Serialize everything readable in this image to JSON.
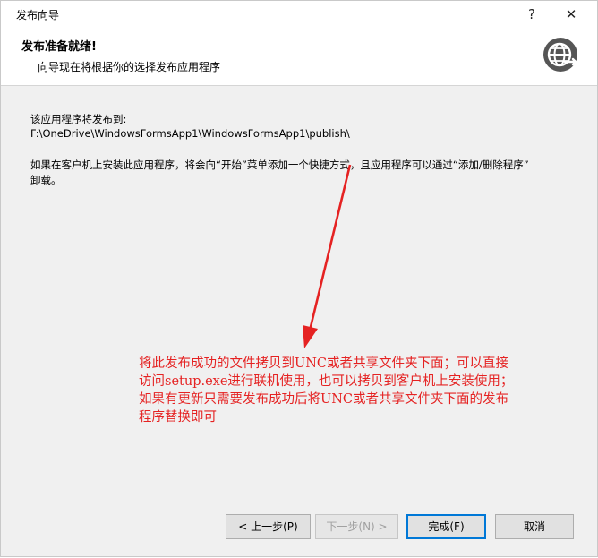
{
  "window": {
    "title": "发布向导",
    "help_label": "?",
    "close_label": "✕"
  },
  "header": {
    "title": "发布准备就绪!",
    "subtitle": "向导现在将根据你的选择发布应用程序"
  },
  "content": {
    "line1": "该应用程序将发布到:",
    "path": "F:\\OneDrive\\WindowsFormsApp1\\WindowsFormsApp1\\publish\\",
    "info_line1": "如果在客户机上安装此应用程序，将会向“开始”菜单添加一个快捷方式，且应用程序可以通过“添加/删除程序”",
    "info_line2": "卸载。"
  },
  "annotation": {
    "lines": [
      "将此发布成功的文件拷贝到UNC或者共享文件夹下面；可以直接",
      "访问setup.exe进行联机使用，也可以拷贝到客户机上安装使用；",
      "如果有更新只需要发布成功后将UNC或者共享文件夹下面的发布",
      "程序替换即可"
    ],
    "color": "#e52222"
  },
  "buttons": {
    "prev": "< 上一步(P)",
    "next": "下一步(N) >",
    "finish": "完成(F)",
    "cancel": "取消"
  },
  "icons": {
    "header_icon": "globe-arrow-icon"
  }
}
